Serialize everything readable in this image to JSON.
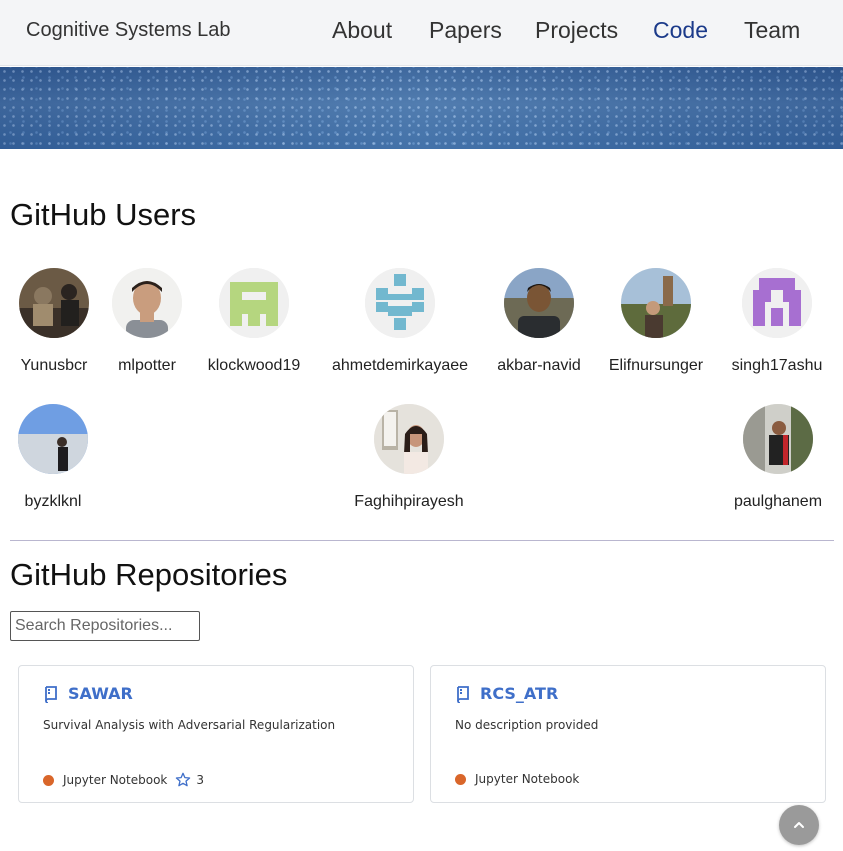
{
  "navbar": {
    "brand": "Cognitive Systems Lab",
    "links": [
      {
        "label": "About",
        "active": false
      },
      {
        "label": "Papers",
        "active": false
      },
      {
        "label": "Projects",
        "active": false
      },
      {
        "label": "Code",
        "active": true
      },
      {
        "label": "Team",
        "active": false
      }
    ],
    "active_color": "#1b3a8a"
  },
  "users_section": {
    "title": "GitHub Users",
    "users": [
      {
        "name": "Yunusbcr",
        "avatar": "photo-avatar"
      },
      {
        "name": "mlpotter",
        "avatar": "photo-avatar"
      },
      {
        "name": "klockwood19",
        "avatar": "identicon-avatar"
      },
      {
        "name": "ahmetdemirkayaee",
        "avatar": "identicon-avatar"
      },
      {
        "name": "akbar-navid",
        "avatar": "photo-avatar"
      },
      {
        "name": "Elifnursunger",
        "avatar": "photo-avatar"
      },
      {
        "name": "singh17ashu",
        "avatar": "identicon-avatar"
      },
      {
        "name": "byzklknl",
        "avatar": "photo-avatar"
      },
      {
        "name": "Faghihpirayesh",
        "avatar": "photo-avatar"
      },
      {
        "name": "paulghanem",
        "avatar": "photo-avatar"
      }
    ]
  },
  "repos_section": {
    "title": "GitHub Repositories",
    "search_placeholder": "Search Repositories...",
    "repos": [
      {
        "name": "SAWAR",
        "description": "Survival Analysis with Adversarial Regularization",
        "language": "Jupyter Notebook",
        "language_color": "#d9662a",
        "stars": "3"
      },
      {
        "name": "RCS_ATR",
        "description": "No description provided",
        "language": "Jupyter Notebook",
        "language_color": "#d9662a"
      }
    ]
  },
  "back_to_top": {
    "icon": "chevron-up-icon"
  },
  "colors": {
    "link_blue": "#3f6fc9",
    "divider": "#b9b6cf",
    "banner": "#2f5f9a"
  }
}
